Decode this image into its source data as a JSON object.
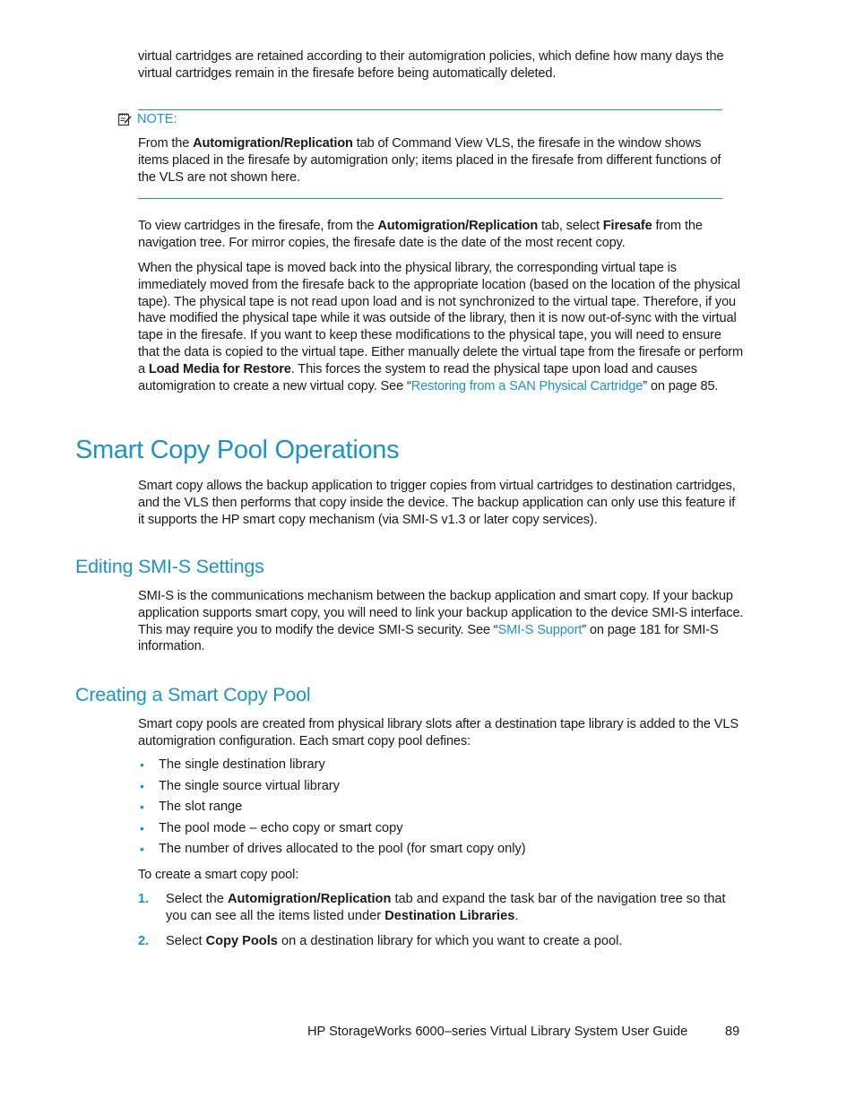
{
  "intro_paragraph": "virtual cartridges are retained according to their automigration policies, which define how many days the virtual cartridges remain in the firesafe before being automatically deleted.",
  "note": {
    "icon": "note-pad-icon",
    "label": "NOTE:",
    "text_before": "From the ",
    "bold": "Automigration/Replication",
    "text_after": " tab of Command View VLS, the firesafe in the window shows items placed in the firesafe by automigration only; items placed in the firesafe from different functions of the VLS are not shown here."
  },
  "firesafe_paragraph": {
    "t1": "To view cartridges in the firesafe, from the ",
    "b1": "Automigration/Replication",
    "t2": " tab, select ",
    "b2": "Firesafe",
    "t3": " from the navigation tree. For mirror copies, the firesafe date is the date of the most recent copy."
  },
  "physical_tape_paragraph": {
    "t1": "When the physical tape is moved back into the physical library, the corresponding virtual tape is immediately moved from the firesafe back to the appropriate location (based on the location of the physical tape). The physical tape is not read upon load and is not synchronized to the virtual tape. Therefore, if you have modified the physical tape while it was outside of the library, then it is now out-of-sync with the virtual tape in the firesafe. If you want to keep these modifications to the physical tape, you will need to ensure that the data is copied to the virtual tape. Either manually delete the virtual tape from the firesafe or perform a ",
    "b1": "Load Media for Restore",
    "t2": ". This forces the system to read the physical tape upon load and causes automigration to create a new virtual copy. See “",
    "link": "Restoring from a SAN Physical Cartridge",
    "t3": "” on page 85."
  },
  "section": {
    "title": "Smart Copy Pool Operations",
    "paragraph": "Smart copy allows the backup application to trigger copies from virtual cartridges to destination cartridges, and the VLS then performs that copy inside the device. The backup application can only use this feature if it supports the HP smart copy mechanism (via SMI-S v1.3 or later copy services)."
  },
  "subsection_smis": {
    "title": "Editing SMI-S Settings",
    "t1": "SMI-S is the communications mechanism between the backup application and smart copy. If your backup application supports smart copy, you will need to link your backup application to the device SMI-S interface. This may require you to modify the device SMI-S security. See “",
    "link": "SMI-S Support",
    "t2": "” on page 181 for SMI-S information."
  },
  "subsection_pool": {
    "title": "Creating a Smart Copy Pool",
    "paragraph": "Smart copy pools are created from physical library slots after a destination tape library is added to the VLS automigration configuration. Each smart copy pool defines:",
    "bullets": [
      "The single destination library",
      "The single source virtual library",
      "The slot range",
      "The pool mode – echo copy or smart copy",
      "The number of drives allocated to the pool (for smart copy only)"
    ],
    "steps_intro": "To create a smart copy pool:",
    "steps": [
      {
        "num": "1.",
        "t1": "Select the ",
        "b1": "Automigration/Replication",
        "t2": " tab and expand the task bar of the navigation tree so that you can see all the items listed under ",
        "b2": "Destination Libraries",
        "t3": "."
      },
      {
        "num": "2.",
        "t1": "Select ",
        "b1": "Copy Pools",
        "t2": " on a destination library for which you want to create a pool."
      }
    ]
  },
  "footer": {
    "title": "HP StorageWorks 6000–series Virtual Library System User Guide",
    "page_number": "89"
  },
  "colors": {
    "accent": "#1a94c9",
    "text": "#1a1a1a"
  }
}
